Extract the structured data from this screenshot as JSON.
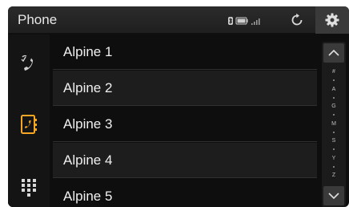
{
  "header": {
    "title": "Phone",
    "icons": [
      "bluetooth-icon",
      "battery-icon",
      "signal-icon",
      "refresh-icon",
      "gear-icon"
    ]
  },
  "nav": {
    "items": [
      {
        "name": "recent-calls",
        "icon": "phone-call-icon",
        "active": false
      },
      {
        "name": "contacts",
        "icon": "contacts-book-icon",
        "active": true
      },
      {
        "name": "keypad",
        "icon": "keypad-icon",
        "active": false
      }
    ]
  },
  "contacts": [
    {
      "name": "Alpine 1"
    },
    {
      "name": "Alpine 2"
    },
    {
      "name": "Alpine 3"
    },
    {
      "name": "Alpine 4"
    },
    {
      "name": "Alpine 5"
    }
  ],
  "index_letters": [
    "#",
    "A",
    "G",
    "M",
    "S",
    "Y",
    "Z"
  ],
  "colors": {
    "accent": "#f5a623",
    "background": "#0e0e0e",
    "text": "#f0f0f0"
  }
}
